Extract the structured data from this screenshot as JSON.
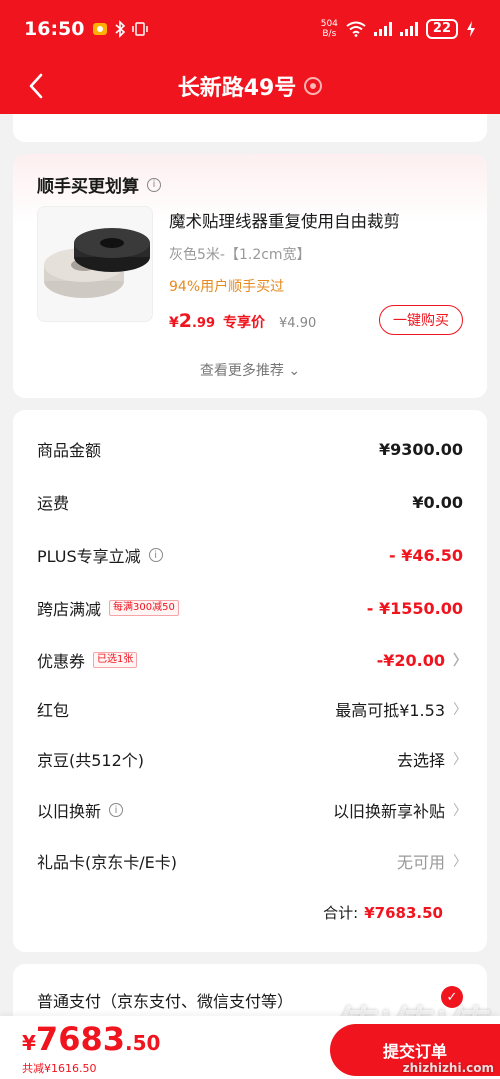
{
  "status": {
    "time": "16:50",
    "net_speed_top": "504",
    "net_speed_bottom": "B/s",
    "battery": "22"
  },
  "header": {
    "title": "长新路49号"
  },
  "recommend": {
    "title": "顺手买更划算",
    "product_name": "魔术贴理线器重复使用自由裁剪",
    "spec": "灰色5米-【1.2cm宽】",
    "ratio": "94%用户顺手买过",
    "price_symbol": "¥",
    "price_int": "2",
    "price_dec": ".99",
    "exclusive_label": "专享价",
    "orig_price": "¥4.90",
    "buy_label": "一键购买",
    "more_label": "查看更多推荐 ⌄"
  },
  "summary": {
    "rows": [
      {
        "label": "商品金额",
        "value": "¥9300.00"
      },
      {
        "label": "运费",
        "value": "¥0.00"
      },
      {
        "label": "PLUS专享立减",
        "value": "- ¥46.50"
      },
      {
        "label": "跨店满减",
        "tag": "每满300减50",
        "value": "- ¥1550.00"
      },
      {
        "label": "优惠券",
        "tag": "已选1张",
        "value": "-¥20.00"
      },
      {
        "label": "红包",
        "value": "最高可抵¥1.53"
      },
      {
        "label": "京豆(共512个)",
        "value": "去选择"
      },
      {
        "label": "以旧换新",
        "value": "以旧换新享补贴"
      },
      {
        "label": "礼品卡(京东卡/E卡)",
        "value": "无可用"
      }
    ],
    "total_label": "合计:",
    "total_value": "¥7683.50"
  },
  "payment": {
    "label": "普通支付（京东支付、微信支付等）"
  },
  "bottom": {
    "symbol": "¥",
    "int": "7683",
    "dec": ".50",
    "saved": "共减¥1616.50",
    "submit": "提交订单",
    "watermark_big": "值|值|值",
    "watermark": "zhizhizhi.com"
  },
  "colors": {
    "brand": "#f0141e",
    "orange": "#e58a1f"
  }
}
